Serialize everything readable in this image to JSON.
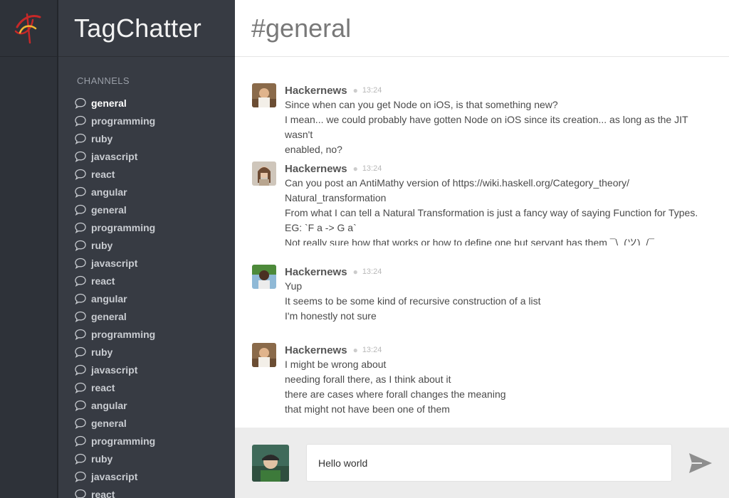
{
  "app": {
    "name": "TagChatter"
  },
  "sidebar": {
    "heading": "CHANNELS",
    "channels": [
      {
        "label": "general",
        "active": true
      },
      {
        "label": "programming"
      },
      {
        "label": "ruby"
      },
      {
        "label": "javascript"
      },
      {
        "label": "react"
      },
      {
        "label": "angular"
      },
      {
        "label": "general"
      },
      {
        "label": "programming"
      },
      {
        "label": "ruby"
      },
      {
        "label": "javascript"
      },
      {
        "label": "react"
      },
      {
        "label": "angular"
      },
      {
        "label": "general"
      },
      {
        "label": "programming"
      },
      {
        "label": "ruby"
      },
      {
        "label": "javascript"
      },
      {
        "label": "react"
      },
      {
        "label": "angular"
      },
      {
        "label": "general"
      },
      {
        "label": "programming"
      },
      {
        "label": "ruby"
      },
      {
        "label": "javascript"
      },
      {
        "label": "react"
      }
    ]
  },
  "header": {
    "title": "#general"
  },
  "messages": [
    {
      "author": "Hackernews",
      "time": "13:24",
      "lines": [
        "Since when can you get Node on iOS, is that something new?",
        "I mean... we could probably have gotten Node on iOS since its creation... as long as the JIT wasn't",
        "enabled, no?"
      ]
    },
    {
      "author": "Hackernews",
      "time": "13:24",
      "lines": [
        "Can you post an AntiMathy version of https://wiki.haskell.org/Category_theory/",
        "Natural_transformation",
        "From what I can tell a Natural Transformation is just a fancy way of saying Function for Types.",
        "EG: `F a -> G a`",
        "Not really sure how that works or how to define one but servant has them ¯\\_(ツ)_/¯"
      ]
    },
    {
      "author": "Hackernews",
      "time": "13:24",
      "lines": [
        "Yup",
        "It seems to be some kind of recursive construction of a list",
        "I'm honestly not sure"
      ]
    },
    {
      "author": "Hackernews",
      "time": "13:24",
      "lines": [
        "I might be wrong about",
        "needing forall there, as I think about it",
        "there are cases where forall changes the meaning",
        "that might not have been one of them"
      ]
    }
  ],
  "composer": {
    "value": "Hello world"
  },
  "icons": {
    "logo": "tagchatter-logo-icon",
    "channel": "speech-bubble-icon",
    "send": "send-arrow-icon"
  },
  "colors": {
    "rail": "#2e3239",
    "sidebar": "#373b43",
    "composer": "#ececec",
    "logo_red": "#c62828",
    "logo_gold": "#f2b632"
  }
}
